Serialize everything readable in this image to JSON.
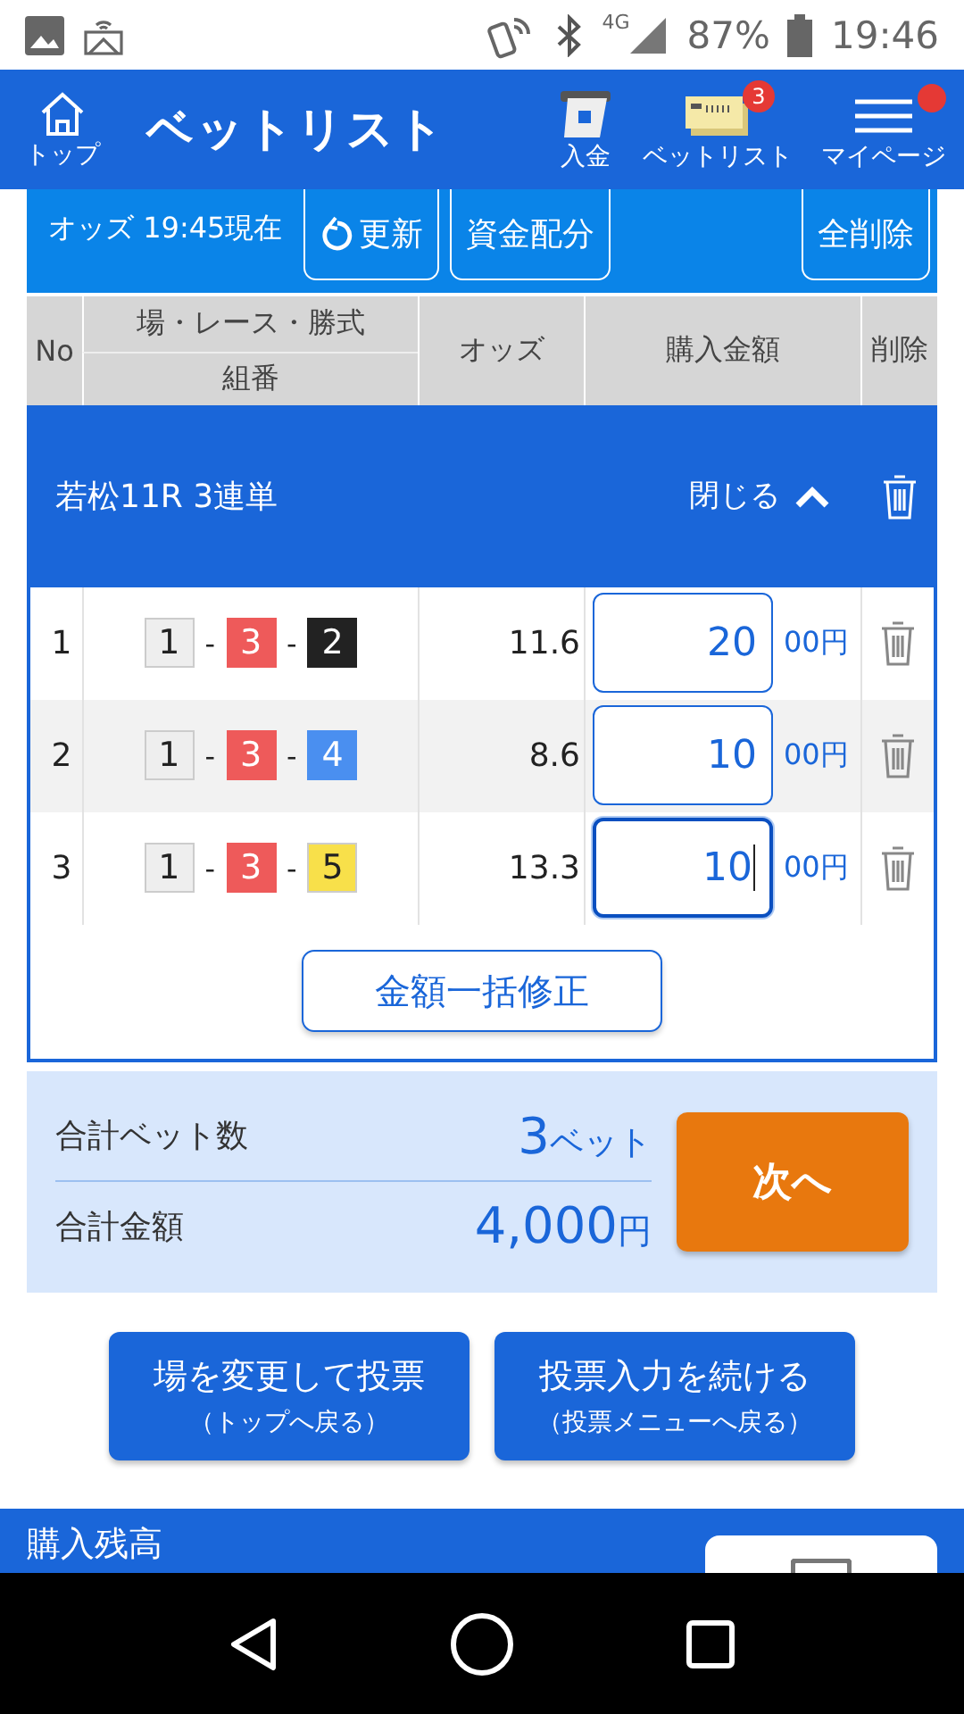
{
  "status_bar": {
    "network": "4G",
    "battery": "87%",
    "time": "19:46"
  },
  "header": {
    "home_label": "トップ",
    "title": "ベットリスト",
    "nav": [
      {
        "kind": "deposit",
        "label": "入金"
      },
      {
        "kind": "betlist",
        "label": "ベットリスト",
        "badge": "3"
      },
      {
        "kind": "menu",
        "label": "マイページ",
        "dot": true
      }
    ]
  },
  "toolbar": {
    "odds_time": "オッズ 19:45現在",
    "refresh": "更新",
    "allocate": "資金配分",
    "delete_all": "全削除"
  },
  "table": {
    "columns": {
      "no": "No",
      "race_top": "場・レース・勝式",
      "race_bottom": "組番",
      "odds": "オッズ",
      "amount": "購入金額",
      "delete": "削除"
    },
    "group": {
      "title": "若松11R 3連単",
      "toggle": "閉じる",
      "expanded": true
    },
    "rows": [
      {
        "no": "1",
        "boats": [
          {
            "number": "1",
            "color": "#eeeeee"
          },
          {
            "number": "3",
            "color": "#ee5a5a"
          },
          {
            "number": "2",
            "color": "#222222"
          }
        ],
        "odds": "11.6",
        "amount": "20",
        "unit": "00円",
        "focused": false
      },
      {
        "no": "2",
        "boats": [
          {
            "number": "1",
            "color": "#eeeeee"
          },
          {
            "number": "3",
            "color": "#ee5a5a"
          },
          {
            "number": "4",
            "color": "#4a8ff0"
          }
        ],
        "odds": "8.6",
        "amount": "10",
        "unit": "00円",
        "focused": false
      },
      {
        "no": "3",
        "boats": [
          {
            "number": "1",
            "color": "#eeeeee"
          },
          {
            "number": "3",
            "color": "#ee5a5a"
          },
          {
            "number": "5",
            "color": "#f8e04a"
          }
        ],
        "odds": "13.3",
        "amount": "10",
        "unit": "00円",
        "focused": true
      }
    ],
    "separator": "-",
    "bulk_edit": "金額一括修正"
  },
  "summary": {
    "count_label": "合計ベット数",
    "count": "3",
    "count_unit": "ベット",
    "total_label": "合計金額",
    "total": "4,000",
    "total_unit": "円",
    "next": "次へ"
  },
  "actions": [
    {
      "title": "場を変更して投票",
      "sub": "（トップへ戻る）"
    },
    {
      "title": "投票入力を続ける",
      "sub": "（投票メニューへ戻る）"
    }
  ],
  "balance": {
    "label": "購入残高"
  }
}
